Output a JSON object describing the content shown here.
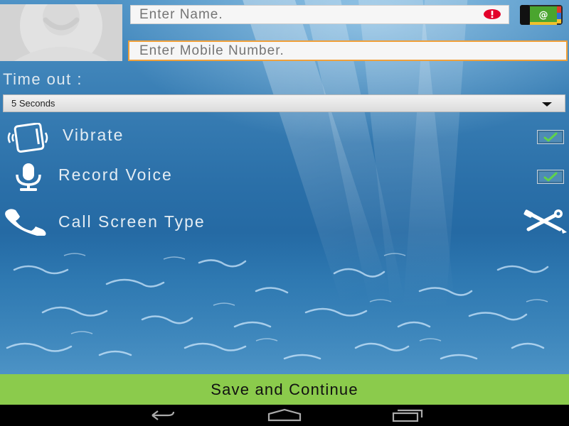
{
  "form": {
    "name_placeholder": "Enter Name.",
    "mobile_placeholder": "Enter Mobile Number."
  },
  "timeout": {
    "label": "Time out :",
    "selected": "5 Seconds"
  },
  "options": {
    "vibrate": {
      "label": "Vibrate",
      "checked": true
    },
    "record_voice": {
      "label": "Record Voice",
      "checked": true
    },
    "call_screen_type": {
      "label": "Call Screen Type"
    }
  },
  "footer": {
    "save_label": "Save and Continue"
  },
  "icons": {
    "avatar": "avatar-placeholder-icon",
    "error": "error-icon",
    "contacts": "contacts-book-icon",
    "vibrate": "vibrate-phone-icon",
    "microphone": "microphone-icon",
    "phone": "phone-handset-icon",
    "tools": "tools-icon",
    "back": "back-icon",
    "home": "home-icon",
    "recents": "recents-icon"
  },
  "colors": {
    "accent_orange": "#f0a03a",
    "save_green": "#8bcb4c",
    "error_red": "#e3002a",
    "check_green": "#5fd34a"
  }
}
